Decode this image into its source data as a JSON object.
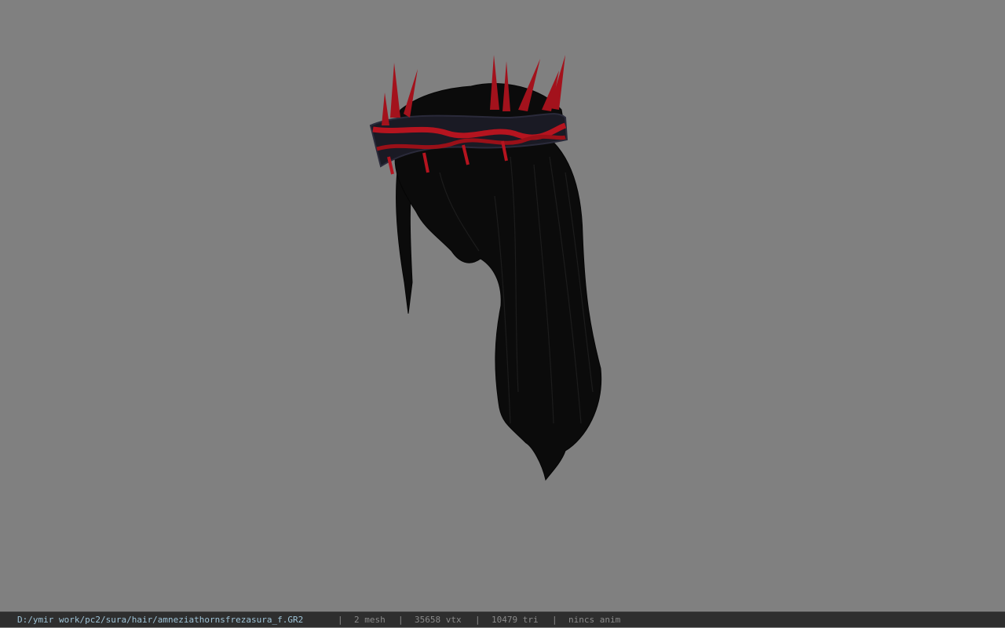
{
  "viewer": {
    "background_color": "#808080",
    "model_icon": "hair-with-thorn-crown-model"
  },
  "statusbar": {
    "file_path": "D:/ymir work/pc2/sura/hair/amneziathornsfrezasura_f.GR2",
    "separator": "|",
    "mesh_count": "2 mesh",
    "vertex_count": "35658 vtx",
    "triangle_count": "10479 tri",
    "animation": "nincs anim"
  },
  "colors": {
    "statusbar_bg": "#2e2e2e",
    "path_text": "#9fc4d8",
    "stats_text": "#8a8a8a",
    "hair": "#0a0a0a",
    "thorn_red": "#b5141f"
  }
}
